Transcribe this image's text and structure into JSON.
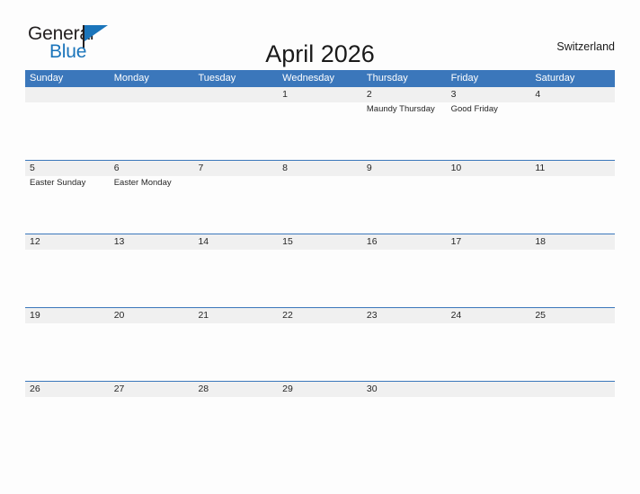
{
  "brand": {
    "name_part1": "General",
    "name_part2": "Blue",
    "flag_icon": "blue-flag-icon",
    "accent_color": "#1b75bb"
  },
  "header": {
    "title": "April 2026",
    "region": "Switzerland"
  },
  "calendar": {
    "header_color": "#3b77bb",
    "day_band_color": "#f0f0f0",
    "weekdays": [
      "Sunday",
      "Monday",
      "Tuesday",
      "Wednesday",
      "Thursday",
      "Friday",
      "Saturday"
    ],
    "weeks": [
      {
        "days": [
          {
            "date": "",
            "event": ""
          },
          {
            "date": "",
            "event": ""
          },
          {
            "date": "",
            "event": ""
          },
          {
            "date": "1",
            "event": ""
          },
          {
            "date": "2",
            "event": "Maundy Thursday"
          },
          {
            "date": "3",
            "event": "Good Friday"
          },
          {
            "date": "4",
            "event": ""
          }
        ]
      },
      {
        "days": [
          {
            "date": "5",
            "event": "Easter Sunday"
          },
          {
            "date": "6",
            "event": "Easter Monday"
          },
          {
            "date": "7",
            "event": ""
          },
          {
            "date": "8",
            "event": ""
          },
          {
            "date": "9",
            "event": ""
          },
          {
            "date": "10",
            "event": ""
          },
          {
            "date": "11",
            "event": ""
          }
        ]
      },
      {
        "days": [
          {
            "date": "12",
            "event": ""
          },
          {
            "date": "13",
            "event": ""
          },
          {
            "date": "14",
            "event": ""
          },
          {
            "date": "15",
            "event": ""
          },
          {
            "date": "16",
            "event": ""
          },
          {
            "date": "17",
            "event": ""
          },
          {
            "date": "18",
            "event": ""
          }
        ]
      },
      {
        "days": [
          {
            "date": "19",
            "event": ""
          },
          {
            "date": "20",
            "event": ""
          },
          {
            "date": "21",
            "event": ""
          },
          {
            "date": "22",
            "event": ""
          },
          {
            "date": "23",
            "event": ""
          },
          {
            "date": "24",
            "event": ""
          },
          {
            "date": "25",
            "event": ""
          }
        ]
      },
      {
        "days": [
          {
            "date": "26",
            "event": ""
          },
          {
            "date": "27",
            "event": ""
          },
          {
            "date": "28",
            "event": ""
          },
          {
            "date": "29",
            "event": ""
          },
          {
            "date": "30",
            "event": ""
          },
          {
            "date": "",
            "event": ""
          },
          {
            "date": "",
            "event": ""
          }
        ]
      }
    ]
  }
}
